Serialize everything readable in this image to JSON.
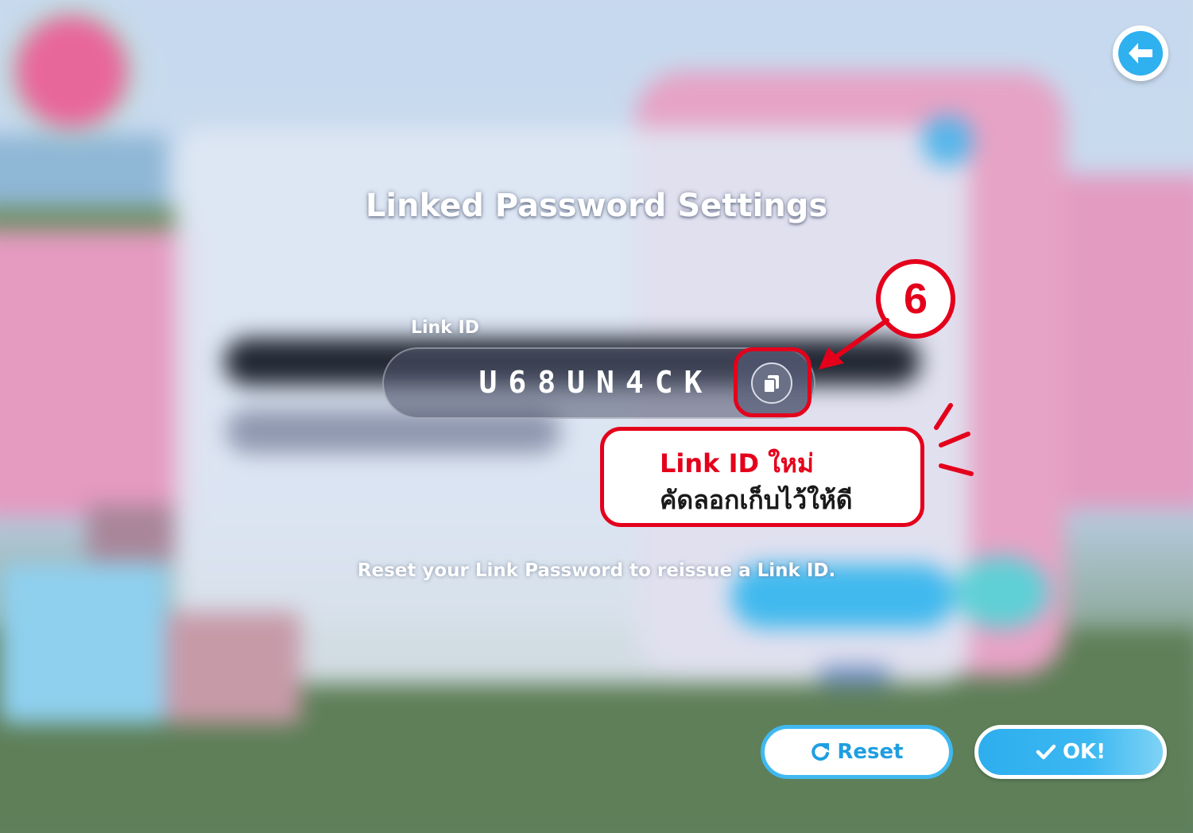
{
  "dialog": {
    "title": "Linked Password Settings",
    "link_id_label": "Link ID",
    "link_id_value": "U68UN4CK",
    "reset_hint": "Reset your Link Password to reissue a Link ID."
  },
  "annotation": {
    "step_number": "6",
    "callout_line1": "Link ID ใหม่",
    "callout_line2": "คัดลอกเก็บไว้ให้ดี",
    "accent_color": "#e4001b"
  },
  "buttons": {
    "reset_label": "Reset",
    "ok_label": "OK!"
  },
  "icons": {
    "back": "back-arrow-icon",
    "copy": "copy-icon",
    "reset": "refresh-icon",
    "ok": "checkmark-icon"
  },
  "colors": {
    "primary_blue": "#2fb0ef",
    "dialog_overlay": "#4e546c"
  }
}
